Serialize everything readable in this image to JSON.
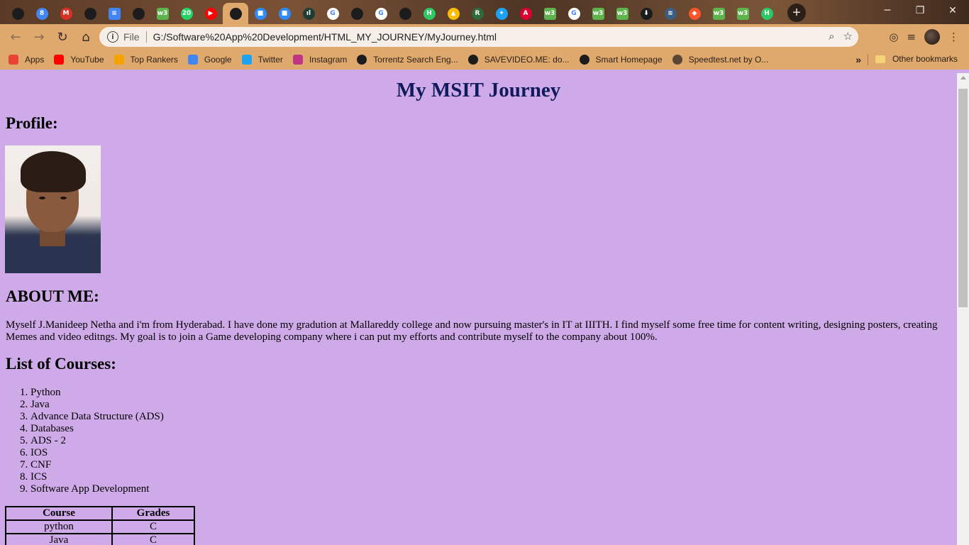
{
  "browser": {
    "tabs": [
      {
        "icon": "globe-icon",
        "color": "#1c1c1c",
        "glyph": ""
      },
      {
        "icon": "calendar-icon",
        "color": "#4285f4",
        "glyph": "8"
      },
      {
        "icon": "gmail-icon",
        "color": "#d93025",
        "glyph": "M"
      },
      {
        "icon": "github-icon",
        "color": "#1c1c1c",
        "glyph": ""
      },
      {
        "icon": "docs-icon",
        "color": "#4285f4",
        "glyph": "≡"
      },
      {
        "icon": "globe-icon",
        "color": "#1c1c1c",
        "glyph": ""
      },
      {
        "icon": "w3schools-icon",
        "color": "#5db34c",
        "glyph": "w3"
      },
      {
        "icon": "whatsapp-icon",
        "color": "#25d366",
        "glyph": "20"
      },
      {
        "icon": "youtube-icon",
        "color": "#ff0000",
        "glyph": "▶"
      },
      {
        "icon": "globe-icon",
        "color": "#1c1c1c",
        "glyph": "",
        "active": true
      },
      {
        "icon": "zoom-icon",
        "color": "#2d8cff",
        "glyph": "■"
      },
      {
        "icon": "zoom-icon",
        "color": "#2d8cff",
        "glyph": "■"
      },
      {
        "icon": "chart-icon",
        "color": "#1f3d35",
        "glyph": "ıl"
      },
      {
        "icon": "google-icon",
        "color": "#ffffff",
        "glyph": "G"
      },
      {
        "icon": "github-icon",
        "color": "#1c1c1c",
        "glyph": ""
      },
      {
        "icon": "google-icon",
        "color": "#ffffff",
        "glyph": "G"
      },
      {
        "icon": "globe-icon",
        "color": "#1c1c1c",
        "glyph": ""
      },
      {
        "icon": "hackerrank-icon",
        "color": "#2ec866",
        "glyph": "H"
      },
      {
        "icon": "drive-icon",
        "color": "#fbbc04",
        "glyph": "▲"
      },
      {
        "icon": "r-icon",
        "color": "#2d6b3a",
        "glyph": "R"
      },
      {
        "icon": "twitter-icon",
        "color": "#1da1f2",
        "glyph": "✦"
      },
      {
        "icon": "angular-icon",
        "color": "#dd0031",
        "glyph": "A"
      },
      {
        "icon": "w3schools-icon",
        "color": "#5db34c",
        "glyph": "w3"
      },
      {
        "icon": "google-icon",
        "color": "#ffffff",
        "glyph": "G"
      },
      {
        "icon": "w3schools-icon",
        "color": "#5db34c",
        "glyph": "w3"
      },
      {
        "icon": "w3schools-icon",
        "color": "#5db34c",
        "glyph": "w3"
      },
      {
        "icon": "download-icon",
        "color": "#1c1c1c",
        "glyph": "⬇"
      },
      {
        "icon": "stack-icon",
        "color": "#3b5f82",
        "glyph": "≋"
      },
      {
        "icon": "brave-icon",
        "color": "#fb542b",
        "glyph": "◆"
      },
      {
        "icon": "w3schools-icon",
        "color": "#5db34c",
        "glyph": "w3"
      },
      {
        "icon": "w3schools-icon",
        "color": "#5db34c",
        "glyph": "w3"
      },
      {
        "icon": "hackerrank-icon",
        "color": "#2ec866",
        "glyph": "H"
      }
    ],
    "address": {
      "scheme_label": "File",
      "url": "G:/Software%20App%20Development/HTML_MY_JOURNEY/MyJourney.html"
    },
    "bookmarks": [
      {
        "label": "Apps",
        "icon": "apps-grid-icon",
        "color": "#ea4335"
      },
      {
        "label": "YouTube",
        "icon": "youtube-icon",
        "color": "#ff0000"
      },
      {
        "label": "Top Rankers",
        "icon": "toprankers-icon",
        "color": "#f4a300"
      },
      {
        "label": "Google",
        "icon": "google-icon",
        "color": "#4285f4"
      },
      {
        "label": "Twitter",
        "icon": "twitter-icon",
        "color": "#1da1f2"
      },
      {
        "label": "Instagram",
        "icon": "instagram-icon",
        "color": "#c13584"
      },
      {
        "label": "Torrentz Search Eng...",
        "icon": "globe-icon",
        "color": "#1c1c1c"
      },
      {
        "label": "SAVEVIDEO.ME: do...",
        "icon": "savevideo-icon",
        "color": "#1c1c1c"
      },
      {
        "label": "Smart Homepage",
        "icon": "globe-icon",
        "color": "#1c1c1c"
      },
      {
        "label": "Speedtest.net by O...",
        "icon": "speedtest-icon",
        "color": "#5a4632"
      }
    ],
    "bookmarks_more": "»",
    "other_bookmarks": "Other bookmarks"
  },
  "page": {
    "title": "My MSIT Journey",
    "profile_heading": "Profile:",
    "about_heading": "ABOUT ME:",
    "about_text": "Myself J.Manideep Netha and i'm from Hyderabad. I have done my gradution at Mallareddy college and now pursuing master's in IT at IIITH. I find myself some free time for content writing, designing posters, creating Memes and video editngs. My goal is to join a Game developing company where i can put my efforts and contribute myself to the company about 100%.",
    "courses_heading": "List of Courses:",
    "courses": [
      "Python",
      "Java",
      "Advance Data Structure (ADS)",
      "Databases",
      "ADS - 2",
      "IOS",
      "CNF",
      "ICS",
      "Software App Development"
    ],
    "grades_table": {
      "headers": [
        "Course",
        "Grades"
      ],
      "rows": [
        [
          "python",
          "C"
        ],
        [
          "Java",
          "C"
        ]
      ]
    }
  }
}
